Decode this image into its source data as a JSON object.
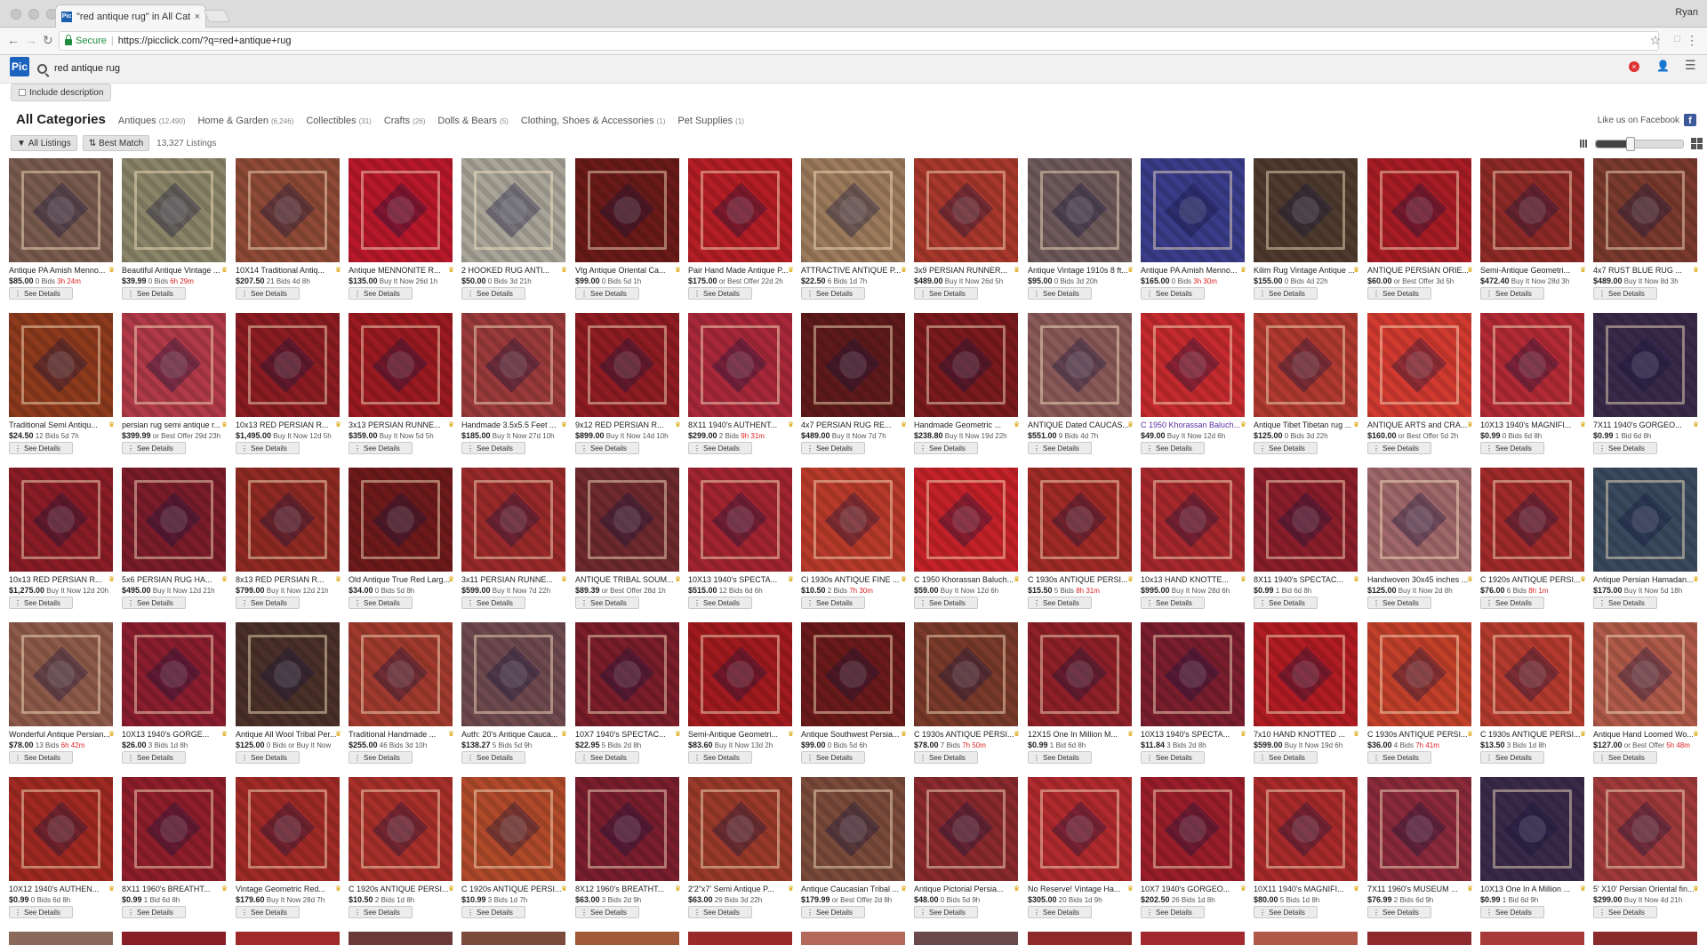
{
  "browser": {
    "tab_title": "\"red antique rug\" in All Catego",
    "tab_close": "×",
    "user": "Ryan",
    "secure_label": "Secure",
    "url": "https://picclick.com/?q=red+antique+rug"
  },
  "site": {
    "logo": "Pic",
    "search_value": "red antique rug",
    "include_description": "Include description"
  },
  "categories": [
    {
      "label": "All Categories",
      "count": ""
    },
    {
      "label": "Antiques",
      "count": "(12,490)"
    },
    {
      "label": "Home & Garden",
      "count": "(6,246)"
    },
    {
      "label": "Collectibles",
      "count": "(31)"
    },
    {
      "label": "Crafts",
      "count": "(26)"
    },
    {
      "label": "Dolls & Bears",
      "count": "(5)"
    },
    {
      "label": "Clothing, Shoes & Accessories",
      "count": "(1)"
    },
    {
      "label": "Pet Supplies",
      "count": "(1)"
    }
  ],
  "facebook": {
    "label": "Like us on Facebook",
    "icon": "f"
  },
  "filters": {
    "all_listings": "All Listings",
    "best_match": "Best Match",
    "count": "13,327 Listings"
  },
  "view": {
    "zoom_fraction": 0.4
  },
  "see_details": "See Details",
  "colors": {
    "accent": "#1b63bf",
    "urgent": "#dd2222",
    "visited": "#5a2ea6"
  },
  "items": [
    {
      "t": "Antique PA Amish Menno...",
      "p": "$85.00",
      "m": "0 Bids ",
      "u": "3h 24m",
      "c": "#7a5b4f"
    },
    {
      "t": "Beautiful Antique Vintage ...",
      "p": "$39.99",
      "m": "0 Bids ",
      "u": "6h 29m",
      "c": "#8a8468"
    },
    {
      "t": "10X14 Traditional Antiq...",
      "p": "$207.50",
      "m": "21 Bids 4d 8h",
      "u": "",
      "c": "#8e4a36"
    },
    {
      "t": "Antique MENNONITE R...",
      "p": "$135.00",
      "m": "Buy It Now 26d 1h",
      "u": "",
      "c": "#b8182a"
    },
    {
      "t": "2 HOOKED RUG ANTI...",
      "p": "$50.00",
      "m": "0 Bids 3d 21h",
      "u": "",
      "c": "#a8a498"
    },
    {
      "t": "Vtg Antique Oriental Ca...",
      "p": "$99.00",
      "m": "0 Bids 5d 1h",
      "u": "",
      "c": "#6a1a18"
    },
    {
      "t": "Pair Hand Made Antique P...",
      "p": "$175.00",
      "m": "or Best Offer 22d 2h",
      "u": "",
      "c": "#b41e24"
    },
    {
      "t": "ATTRACTIVE ANTIQUE P...",
      "p": "$22.50",
      "m": "6 Bids 1d 7h",
      "u": "",
      "c": "#9c7a5c"
    },
    {
      "t": "3x9 PERSIAN RUNNER...",
      "p": "$489.00",
      "m": "Buy It Now 26d 5h",
      "u": "",
      "c": "#a8382c"
    },
    {
      "t": "Antique Vintage 1910s 8 ft...",
      "p": "$95.00",
      "m": "0 Bids 3d 20h",
      "u": "",
      "c": "#6e5a5a"
    },
    {
      "t": "Antique PA Amish Menno...",
      "p": "$165.00",
      "m": "0 Bids ",
      "u": "3h 30m",
      "c": "#3a3c8a"
    },
    {
      "t": "Kilim Rug Vintage Antique ...",
      "p": "$155.00",
      "m": "0 Bids 4d 22h",
      "u": "",
      "c": "#4e3a2e"
    },
    {
      "t": "ANTIQUE PERSIAN ORIE...",
      "p": "$60.00",
      "m": "or Best Offer 3d 5h",
      "u": "",
      "c": "#a81c24"
    },
    {
      "t": "Semi-Antique Geometri...",
      "p": "$472.40",
      "m": "Buy It Now 28d 3h",
      "u": "",
      "c": "#8e2a26"
    },
    {
      "t": "4x7 RUST BLUE RUG ...",
      "p": "$489.00",
      "m": "Buy It Now 8d 3h",
      "u": "",
      "c": "#7a3a2e"
    },
    {
      "t": "Traditional Semi Antiqu...",
      "p": "$24.50",
      "m": "12 Bids 5d 7h",
      "u": "",
      "c": "#8e3a1c"
    },
    {
      "t": "persian rug semi antique r...",
      "p": "$399.99",
      "m": "or Best Offer 29d 23h",
      "u": "",
      "c": "#b03a48"
    },
    {
      "t": "10x13 RED PERSIAN R...",
      "p": "$1,495.00",
      "m": "Buy It Now 12d 5h",
      "u": "",
      "c": "#8a1c22"
    },
    {
      "t": "3x13 PERSIAN RUNNE...",
      "p": "$359.00",
      "m": "Buy It Now 5d 5h",
      "u": "",
      "c": "#9a1a20"
    },
    {
      "t": "Handmade 3.5x5.5 Feet ...",
      "p": "$185.00",
      "m": "Buy It Now 27d 10h",
      "u": "",
      "c": "#9a3a3a"
    },
    {
      "t": "9x12 RED PERSIAN R...",
      "p": "$899.00",
      "m": "Buy It Now 14d 10h",
      "u": "",
      "c": "#8e1c22"
    },
    {
      "t": "8X11 1940's AUTHENT...",
      "p": "$299.00",
      "m": "2 Bids ",
      "u": "9h 31m",
      "c": "#a8283a"
    },
    {
      "t": "4x7 PERSIAN RUG RE...",
      "p": "$489.00",
      "m": "Buy It Now 7d 7h",
      "u": "",
      "c": "#5e1a1a"
    },
    {
      "t": "Handmade Geometric ...",
      "p": "$238.80",
      "m": "Buy It Now 19d 22h",
      "u": "",
      "c": "#7a1a1e"
    },
    {
      "t": "ANTIQUE Dated CAUCAS...",
      "p": "$551.00",
      "m": "9 Bids 4d 7h",
      "u": "",
      "c": "#8a5a58"
    },
    {
      "t": "C 1950 Khorassan Baluch...",
      "p": "$49.00",
      "m": "Buy It Now 12d 6h",
      "u": "",
      "c": "#c42a2e",
      "v": true
    },
    {
      "t": "Antique Tibet Tibetan rug ...",
      "p": "$125.00",
      "m": "0 Bids 3d 22h",
      "u": "",
      "c": "#b03a30"
    },
    {
      "t": "ANTIQUE ARTS and CRA...",
      "p": "$160.00",
      "m": "or Best Offer 5d 2h",
      "u": "",
      "c": "#d23a30"
    },
    {
      "t": "10X13 1940's MAGNIFI...",
      "p": "$0.99",
      "m": "0 Bids 6d 8h",
      "u": "",
      "c": "#b22a34"
    },
    {
      "t": "7X11 1940's GORGEO...",
      "p": "$0.99",
      "m": "1 Bid 6d 8h",
      "u": "",
      "c": "#3a2a4a"
    },
    {
      "t": "10x13 RED PERSIAN R...",
      "p": "$1,275.00",
      "m": "Buy It Now 12d 20h",
      "u": "",
      "c": "#8a1c26"
    },
    {
      "t": "5x6 PERSIAN RUG HA...",
      "p": "$495.00",
      "m": "Buy It Now 12d 21h",
      "u": "",
      "c": "#7a1c2a"
    },
    {
      "t": "8x13 RED PERSIAN R...",
      "p": "$799.00",
      "m": "Buy It Now 12d 21h",
      "u": "",
      "c": "#8e2a22"
    },
    {
      "t": "Old Antique True Red Larg...",
      "p": "$34.00",
      "m": "0 Bids 5d 8h",
      "u": "",
      "c": "#6e1a1a"
    },
    {
      "t": "3x11 PERSIAN RUNNE...",
      "p": "$599.00",
      "m": "Buy It Now 7d 22h",
      "u": "",
      "c": "#9a2a2a"
    },
    {
      "t": "ANTIQUE TRIBAL SOUM...",
      "p": "$89.39",
      "m": "or Best Offer 28d 1h",
      "u": "",
      "c": "#6e2a2e"
    },
    {
      "t": "10X13 1940's SPECTA...",
      "p": "$515.00",
      "m": "12 Bids 6d 6h",
      "u": "",
      "c": "#a22430"
    },
    {
      "t": "Ci 1930s ANTIQUE FINE ...",
      "p": "$10.50",
      "m": "2 Bids ",
      "u": "7h 30m",
      "c": "#b83a2a"
    },
    {
      "t": "C 1950 Khorassan Baluch...",
      "p": "$59.00",
      "m": "Buy It Now 12d 6h",
      "u": "",
      "c": "#c42228"
    },
    {
      "t": "C 1930s ANTIQUE PERSI...",
      "p": "$15.50",
      "m": "5 Bids ",
      "u": "8h 31m",
      "c": "#a02a26"
    },
    {
      "t": "10x13 HAND KNOTTE...",
      "p": "$995.00",
      "m": "Buy It Now 28d 6h",
      "u": "",
      "c": "#a6282c"
    },
    {
      "t": "8X11 1940's SPECTAC...",
      "p": "$0.99",
      "m": "1 Bid 6d 8h",
      "u": "",
      "c": "#8a1e2a"
    },
    {
      "t": "Handwoven 30x45 inches ...",
      "p": "$125.00",
      "m": "Buy It Now 2d 8h",
      "u": "",
      "c": "#a0686a"
    },
    {
      "t": "C 1920s ANTIQUE PERSI...",
      "p": "$76.00",
      "m": "6 Bids ",
      "u": "8h 1m",
      "c": "#a02a2a"
    },
    {
      "t": "Antique Persian Hamadan...",
      "p": "$175.00",
      "m": "Buy It Now 5d 18h",
      "u": "",
      "c": "#3a4a5e"
    },
    {
      "t": "Wonderful Antique Persian...",
      "p": "$78.00",
      "m": "13 Bids ",
      "u": "6h 42m",
      "c": "#8e5a4a"
    },
    {
      "t": "10X13 1940's GORGE...",
      "p": "$26.00",
      "m": "3 Bids 1d 8h",
      "u": "",
      "c": "#8a1e2e"
    },
    {
      "t": "Antique All Wool Tribal Per...",
      "p": "$125.00",
      "m": "0 Bids or Buy It Now",
      "u": "",
      "c": "#4a3028"
    },
    {
      "t": "Traditional Handmade ...",
      "p": "$255.00",
      "m": "46 Bids 3d 10h",
      "u": "",
      "c": "#a03a2e"
    },
    {
      "t": "Auth: 20's Antique Cauca...",
      "p": "$138.27",
      "m": "5 Bids 5d 9h",
      "u": "",
      "c": "#6e4a4e"
    },
    {
      "t": "10X7 1940's SPECTAC...",
      "p": "$22.95",
      "m": "5 Bids 2d 8h",
      "u": "",
      "c": "#7a1e2a"
    },
    {
      "t": "Semi-Antique Geometri...",
      "p": "$83.60",
      "m": "Buy It Now 13d 2h",
      "u": "",
      "c": "#a01a1e"
    },
    {
      "t": "Antique Southwest Persia...",
      "p": "$99.00",
      "m": "0 Bids 5d 6h",
      "u": "",
      "c": "#6a1a1a"
    },
    {
      "t": "C 1930s ANTIQUE PERSI...",
      "p": "$78.00",
      "m": "7 Bids ",
      "u": "7h 50m",
      "c": "#7a3a2a"
    },
    {
      "t": "12X15 One In Million M...",
      "p": "$0.99",
      "m": "1 Bid 6d 8h",
      "u": "",
      "c": "#8e2028"
    },
    {
      "t": "10X13 1940's SPECTA...",
      "p": "$11.84",
      "m": "3 Bids 2d 8h",
      "u": "",
      "c": "#7a1e2e"
    },
    {
      "t": "7x10 HAND KNOTTED ...",
      "p": "$599.00",
      "m": "Buy It Now 19d 6h",
      "u": "",
      "c": "#b01c22"
    },
    {
      "t": "C 1930s ANTIQUE PERSI...",
      "p": "$36.00",
      "m": "4 Bids ",
      "u": "7h 41m",
      "c": "#c2402a"
    },
    {
      "t": "C 1930s ANTIQUE PERSI...",
      "p": "$13.50",
      "m": "3 Bids 1d 8h",
      "u": "",
      "c": "#b43a2e"
    },
    {
      "t": "Antique Hand Loomed Wo...",
      "p": "$127.00",
      "m": "or Best Offer ",
      "u": "5h 48m",
      "c": "#b05a4a"
    },
    {
      "t": "10X12 1940's AUTHEN...",
      "p": "$0.99",
      "m": "0 Bids 6d 8h",
      "u": "",
      "c": "#a02a22"
    },
    {
      "t": "8X11 1960's BREATHT...",
      "p": "$0.99",
      "m": "1 Bid 6d 8h",
      "u": "",
      "c": "#8e1e2a"
    },
    {
      "t": "Vintage Geometric Red...",
      "p": "$179.60",
      "m": "Buy It Now 28d 7h",
      "u": "",
      "c": "#a02a26"
    },
    {
      "t": "C 1920s ANTIQUE PERSI...",
      "p": "$10.50",
      "m": "2 Bids 1d 8h",
      "u": "",
      "c": "#a8302a"
    },
    {
      "t": "C 1920s ANTIQUE PERSI...",
      "p": "$10.99",
      "m": "3 Bids 1d 7h",
      "u": "",
      "c": "#b04a2a"
    },
    {
      "t": "8X12 1960's BREATHT...",
      "p": "$63.00",
      "m": "3 Bids 2d 9h",
      "u": "",
      "c": "#7a1e2e"
    },
    {
      "t": "2'2\"x7' Semi Antique P...",
      "p": "$63.00",
      "m": "29 Bids 3d 22h",
      "u": "",
      "c": "#9a3a2a"
    },
    {
      "t": "Antique Caucasian Tribal ...",
      "p": "$179.99",
      "m": "or Best Offer 2d 8h",
      "u": "",
      "c": "#7a4a3a"
    },
    {
      "t": "Antique Pictorial Persia...",
      "p": "$48.00",
      "m": "0 Bids 5d 9h",
      "u": "",
      "c": "#8a2a2e"
    },
    {
      "t": "No Reserve! Vintage Ha...",
      "p": "$305.00",
      "m": "20 Bids 1d 9h",
      "u": "",
      "c": "#b02a2e"
    },
    {
      "t": "10X7 1940's GORGEO...",
      "p": "$202.50",
      "m": "26 Bids 1d 8h",
      "u": "",
      "c": "#9a1e2a"
    },
    {
      "t": "10X11 1940's MAGNIFI...",
      "p": "$80.00",
      "m": "5 Bids 1d 8h",
      "u": "",
      "c": "#a82a2a"
    },
    {
      "t": "7X11 1960's MUSEUM ...",
      "p": "$76.99",
      "m": "2 Bids 6d 9h",
      "u": "",
      "c": "#8a2a3a"
    },
    {
      "t": "10X13 One In A Million ...",
      "p": "$0.99",
      "m": "1 Bid 6d 9h",
      "u": "",
      "c": "#3a2a4a"
    },
    {
      "t": "5' X10' Persian Oriental fin...",
      "p": "$299.00",
      "m": "Buy It Now 4d 21h",
      "u": "",
      "c": "#a03a3a"
    }
  ],
  "next_row_colors": [
    "#8a6a5a",
    "#8a1e26",
    "#a02a2a",
    "#6a3a3a",
    "#7a4a3a",
    "#a05a3a",
    "#9a2a2a",
    "#b46a5a",
    "#6a4a4a",
    "#8e2a2a",
    "#a02a2e",
    "#b05a4a",
    "#8e2a2e",
    "#a83a3a",
    "#8a2a2a"
  ]
}
